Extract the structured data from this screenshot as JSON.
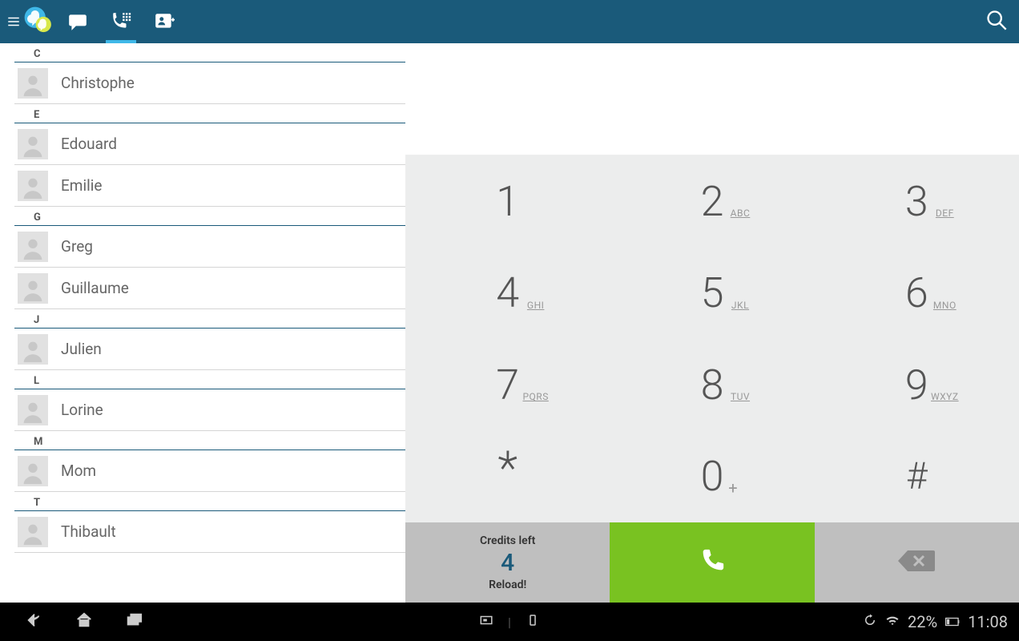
{
  "topbar": {
    "tabs": [
      "messages",
      "dialer",
      "add-contact"
    ],
    "active_tab_index": 1
  },
  "contacts": {
    "sections": [
      {
        "letter": "C",
        "items": [
          {
            "name": "Christophe"
          }
        ]
      },
      {
        "letter": "E",
        "items": [
          {
            "name": "Edouard"
          },
          {
            "name": "Emilie"
          }
        ]
      },
      {
        "letter": "G",
        "items": [
          {
            "name": "Greg"
          },
          {
            "name": "Guillaume"
          }
        ]
      },
      {
        "letter": "J",
        "items": [
          {
            "name": "Julien"
          }
        ]
      },
      {
        "letter": "L",
        "items": [
          {
            "name": "Lorine"
          }
        ]
      },
      {
        "letter": "M",
        "items": [
          {
            "name": "Mom"
          }
        ]
      },
      {
        "letter": "T",
        "items": [
          {
            "name": "Thibault"
          }
        ]
      }
    ]
  },
  "dialer": {
    "number_display": "",
    "keys": [
      {
        "digit": "1",
        "letters": ""
      },
      {
        "digit": "2",
        "letters": "ABC"
      },
      {
        "digit": "3",
        "letters": "DEF"
      },
      {
        "digit": "4",
        "letters": "GHI"
      },
      {
        "digit": "5",
        "letters": "JKL"
      },
      {
        "digit": "6",
        "letters": "MNO"
      },
      {
        "digit": "7",
        "letters": "PQRS"
      },
      {
        "digit": "8",
        "letters": "TUV"
      },
      {
        "digit": "9",
        "letters": "WXYZ"
      },
      {
        "digit": "*",
        "letters": ""
      },
      {
        "digit": "0",
        "letters": "+"
      },
      {
        "digit": "#",
        "letters": ""
      }
    ],
    "credits": {
      "label": "Credits left",
      "count": "4",
      "reload": "Reload!"
    }
  },
  "statusbar": {
    "battery_percent": "22%",
    "time": "11:08"
  }
}
